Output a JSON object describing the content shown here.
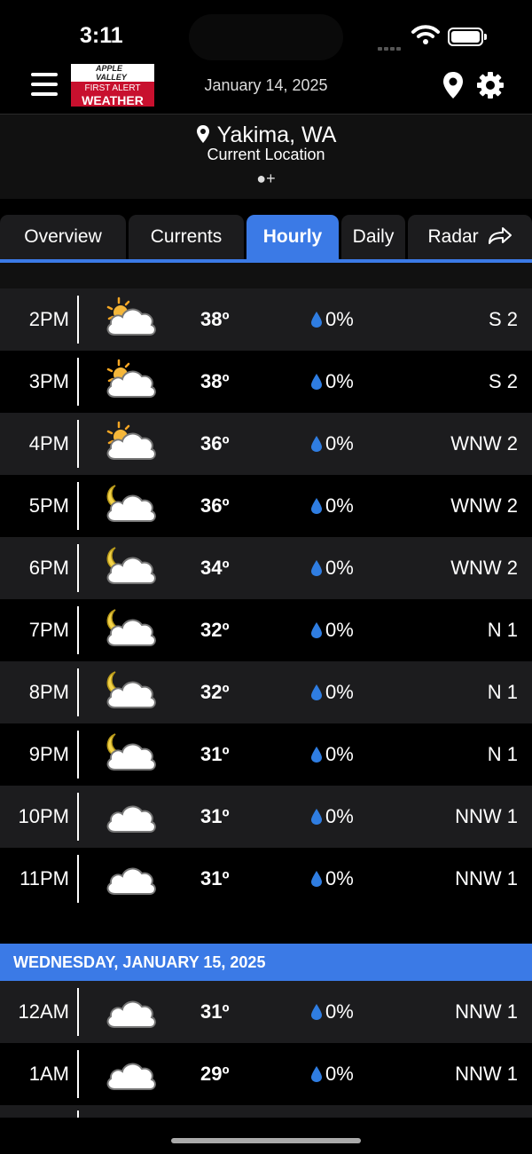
{
  "status_bar": {
    "time": "3:11"
  },
  "header": {
    "logo_top": "APPLE VALLEY",
    "logo_line1": "FIRST ALERT",
    "logo_line2": "WEATHER",
    "date": "January 14, 2025"
  },
  "location": {
    "city": "Yakima, WA",
    "subtitle": "Current Location",
    "pager": "●+"
  },
  "tabs": [
    {
      "label": "Overview"
    },
    {
      "label": "Currents"
    },
    {
      "label": "Hourly"
    },
    {
      "label": "Daily"
    },
    {
      "label": "Radar"
    }
  ],
  "hours_today": [
    {
      "time": "2PM",
      "icon": "sun-cloud-icon",
      "temp": "38º",
      "precip": "0%",
      "wind": "S 2"
    },
    {
      "time": "3PM",
      "icon": "sun-cloud-icon",
      "temp": "38º",
      "precip": "0%",
      "wind": "S 2"
    },
    {
      "time": "4PM",
      "icon": "sun-cloud-icon",
      "temp": "36º",
      "precip": "0%",
      "wind": "WNW 2"
    },
    {
      "time": "5PM",
      "icon": "moon-cloud-icon",
      "temp": "36º",
      "precip": "0%",
      "wind": "WNW 2"
    },
    {
      "time": "6PM",
      "icon": "moon-cloud-icon",
      "temp": "34º",
      "precip": "0%",
      "wind": "WNW 2"
    },
    {
      "time": "7PM",
      "icon": "moon-cloud-icon",
      "temp": "32º",
      "precip": "0%",
      "wind": "N 1"
    },
    {
      "time": "8PM",
      "icon": "moon-cloud-icon",
      "temp": "32º",
      "precip": "0%",
      "wind": "N 1"
    },
    {
      "time": "9PM",
      "icon": "moon-cloud-icon",
      "temp": "31º",
      "precip": "0%",
      "wind": "N 1"
    },
    {
      "time": "10PM",
      "icon": "cloud-icon",
      "temp": "31º",
      "precip": "0%",
      "wind": "NNW 1"
    },
    {
      "time": "11PM",
      "icon": "cloud-icon",
      "temp": "31º",
      "precip": "0%",
      "wind": "NNW 1"
    }
  ],
  "day_header": "WEDNESDAY, JANUARY 15, 2025",
  "hours_tomorrow": [
    {
      "time": "12AM",
      "icon": "cloud-icon",
      "temp": "31º",
      "precip": "0%",
      "wind": "NNW 1"
    },
    {
      "time": "1AM",
      "icon": "cloud-icon",
      "temp": "29º",
      "precip": "0%",
      "wind": "NNW 1"
    }
  ],
  "colors": {
    "accent": "#3b7ae6",
    "row_alt": "#1c1c1e",
    "drop": "#2f7de1",
    "logo_red": "#c8102e"
  }
}
